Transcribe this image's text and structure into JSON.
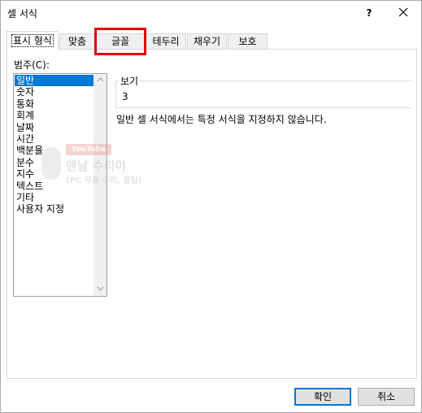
{
  "window": {
    "title": "셀 서식",
    "help_label": "?"
  },
  "tabs": [
    {
      "label": "표시 형식",
      "active": true
    },
    {
      "label": "맞춤",
      "active": false
    },
    {
      "label": "글꼴",
      "active": false
    },
    {
      "label": "테두리",
      "active": false
    },
    {
      "label": "채우기",
      "active": false
    },
    {
      "label": "보호",
      "active": false
    }
  ],
  "category": {
    "label": "범주(C):",
    "items": [
      "일반",
      "숫자",
      "통화",
      "회계",
      "날짜",
      "시간",
      "백분율",
      "분수",
      "지수",
      "텍스트",
      "기타",
      "사용자 지정"
    ],
    "selected": "일반"
  },
  "sample": {
    "legend": "보기",
    "value": "3"
  },
  "description": "일반 셀 서식에서는 특정 서식을 지정하지 않습니다.",
  "watermark": {
    "badge": "YouTube",
    "title": "맨날 수리야",
    "subtitle": "(PC 무료 수리, 꿀팁)"
  },
  "buttons": {
    "ok": "확인",
    "cancel": "취소"
  },
  "colors": {
    "selection": "#0078d7",
    "highlight_box": "#e00000"
  }
}
